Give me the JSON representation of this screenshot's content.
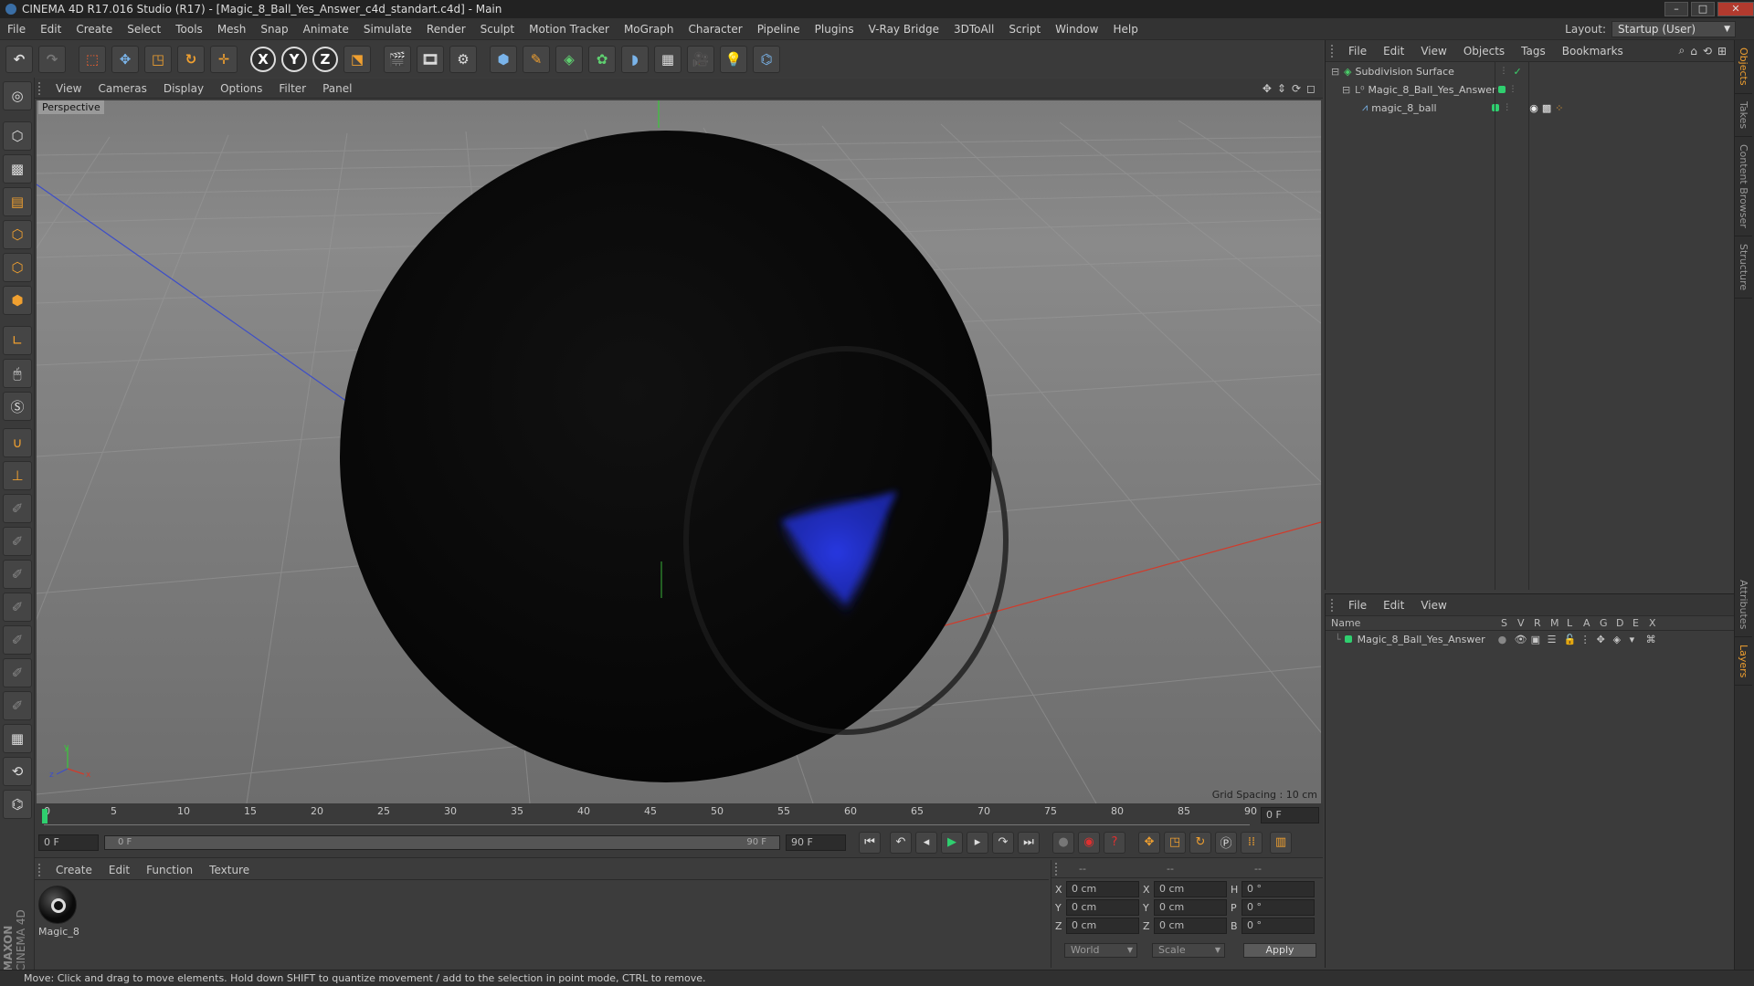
{
  "title_bar": {
    "title": "CINEMA 4D R17.016 Studio (R17) - [Magic_8_Ball_Yes_Answer_c4d_standart.c4d] - Main"
  },
  "menu": {
    "items": [
      "File",
      "Edit",
      "Create",
      "Select",
      "Tools",
      "Mesh",
      "Snap",
      "Animate",
      "Simulate",
      "Render",
      "Sculpt",
      "Motion Tracker",
      "MoGraph",
      "Character",
      "Pipeline",
      "Plugins",
      "V-Ray Bridge",
      "3DToAll",
      "Script",
      "Window",
      "Help"
    ],
    "layout_label": "Layout:",
    "layout_value": "Startup (User)"
  },
  "toolbar": {
    "axes": [
      "X",
      "Y",
      "Z"
    ]
  },
  "viewport": {
    "menu": [
      "View",
      "Cameras",
      "Display",
      "Options",
      "Filter",
      "Panel"
    ],
    "camera_label": "Perspective",
    "grid_spacing": "Grid Spacing : 10 cm",
    "axis_x": "x",
    "axis_y": "y",
    "axis_z": "z"
  },
  "timeline": {
    "ticks": [
      "0",
      "5",
      "10",
      "15",
      "20",
      "25",
      "30",
      "35",
      "40",
      "45",
      "50",
      "55",
      "60",
      "65",
      "70",
      "75",
      "80",
      "85",
      "90"
    ],
    "current_frame": "0 F"
  },
  "transport": {
    "start": "0 F",
    "range_start": "0 F",
    "range_end": "90 F",
    "end": "90 F"
  },
  "material_panel": {
    "menu": [
      "Create",
      "Edit",
      "Function",
      "Texture"
    ],
    "material_name": "Magic_8"
  },
  "coordinates": {
    "headers": [
      "--",
      "--",
      "--"
    ],
    "rows": [
      {
        "label": "X",
        "pos": "0 cm",
        "size_label": "X",
        "size": "0 cm",
        "rot_label": "H",
        "rot": "0 °"
      },
      {
        "label": "Y",
        "pos": "0 cm",
        "size_label": "Y",
        "size": "0 cm",
        "rot_label": "P",
        "rot": "0 °"
      },
      {
        "label": "Z",
        "pos": "0 cm",
        "size_label": "Z",
        "size": "0 cm",
        "rot_label": "B",
        "rot": "0 °"
      }
    ],
    "world": "World",
    "scale": "Scale",
    "apply": "Apply"
  },
  "object_manager": {
    "menu": [
      "File",
      "Edit",
      "View",
      "Objects",
      "Tags",
      "Bookmarks"
    ],
    "objects": [
      {
        "name": "Subdivision Surface"
      },
      {
        "name": "Magic_8_Ball_Yes_Answer"
      },
      {
        "name": "magic_8_ball"
      }
    ]
  },
  "layer_manager": {
    "menu": [
      "File",
      "Edit",
      "View"
    ],
    "columns": [
      "Name",
      "S",
      "V",
      "R",
      "M",
      "L",
      "A",
      "G",
      "D",
      "E",
      "X"
    ],
    "layers": [
      {
        "name": "Magic_8_Ball_Yes_Answer",
        "color": "#2fcf6f"
      }
    ]
  },
  "side_tabs": [
    "Objects",
    "Takes",
    "Content Browser",
    "Structure",
    "Attributes",
    "Layers"
  ],
  "brand": {
    "line1": "MAXON",
    "line2": "CINEMA 4D"
  },
  "status_bar": {
    "text": "Move: Click and drag to move elements. Hold down SHIFT to quantize movement / add to the selection in point mode, CTRL to remove."
  },
  "colors": {
    "accent": "#f0a030",
    "layer_green": "#2fcf6f",
    "x_axis": "#d23a2a",
    "z_axis": "#3d4ec8",
    "y_axis": "#3ac83a"
  }
}
